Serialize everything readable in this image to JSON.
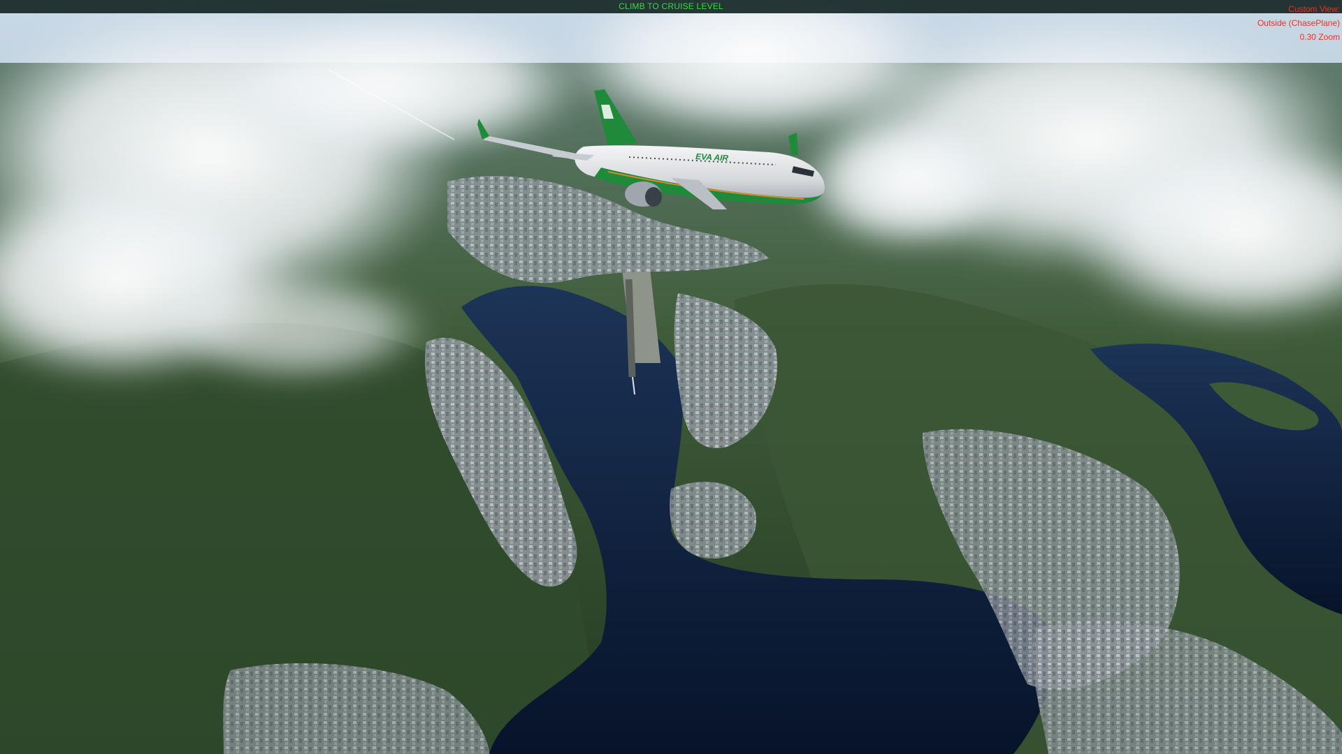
{
  "hud": {
    "phase_message": "CLIMB TO CRUISE LEVEL",
    "camera": {
      "view_name": "Custom View:",
      "view_mode": "Outside (ChasePlane)",
      "zoom": "0.30 Zoom"
    }
  },
  "aircraft": {
    "livery_text": "EVA AIR"
  },
  "colors": {
    "phase_message": "#3fd54a",
    "camera_info": "#ff2a1a",
    "top_bar": "#162626",
    "water": "#0c1b33",
    "terrain": "#35522e",
    "livery_green": "#1f8a3a"
  }
}
